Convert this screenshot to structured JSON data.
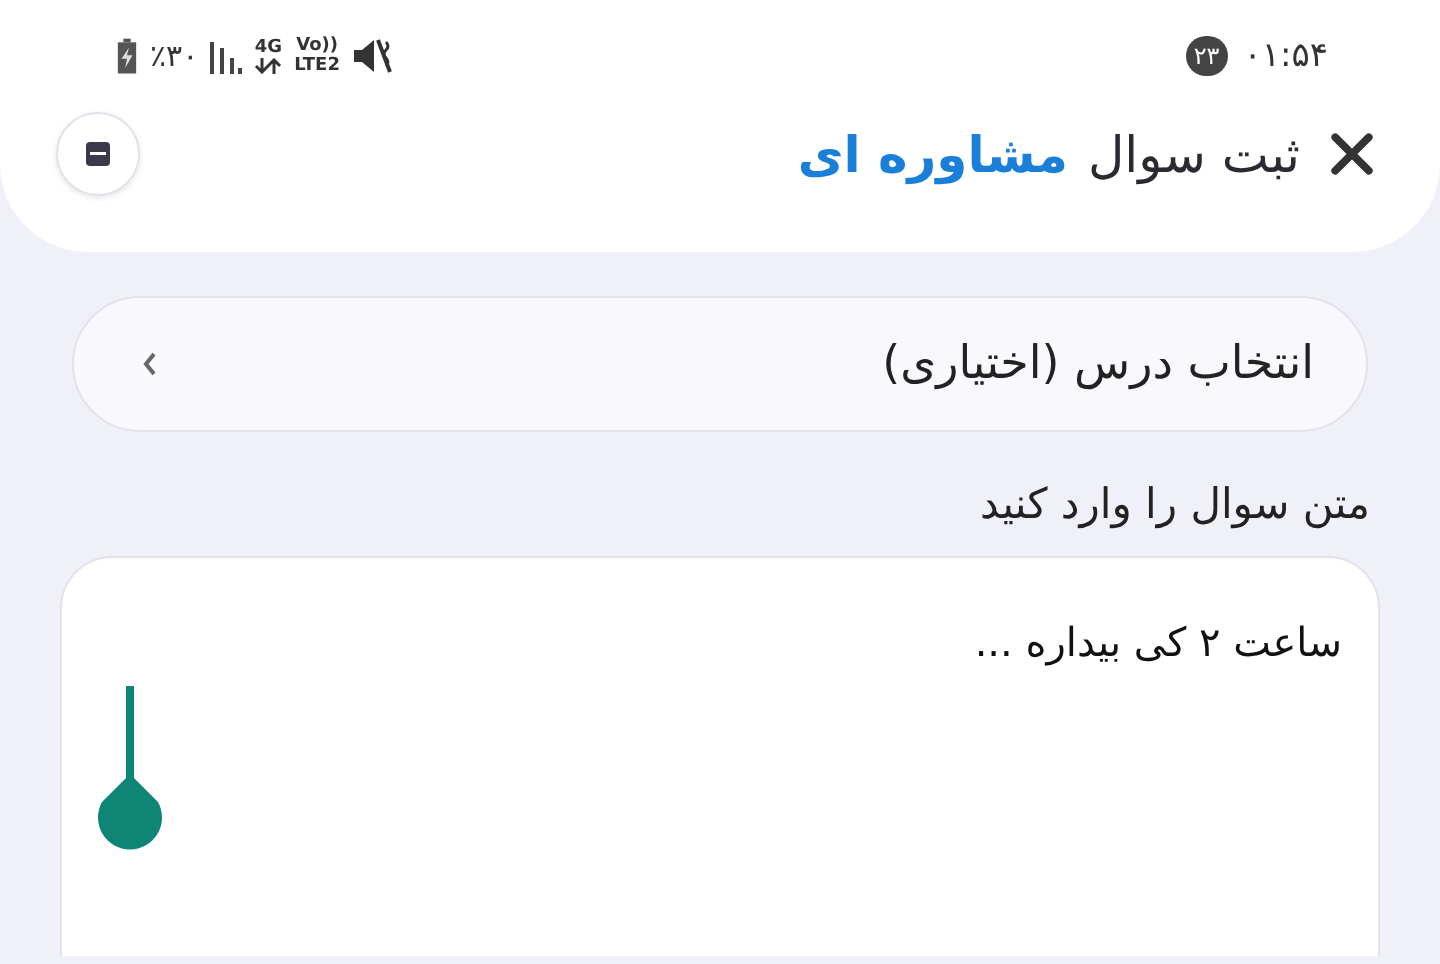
{
  "status_bar": {
    "time": "۰۱:۵۴",
    "notification_count": "۲۳",
    "battery": "٪۳۰",
    "network": "4G",
    "volte_top": "Vo))",
    "volte_bottom": "LTE2"
  },
  "header": {
    "title": "ثبت سوال",
    "title_highlight": "مشاوره ای"
  },
  "course_select": {
    "label": "انتخاب درس (اختیاری)"
  },
  "question": {
    "label": "متن سوال را وارد کنید",
    "value": "ساعت ۲ کی بیداره ..."
  }
}
